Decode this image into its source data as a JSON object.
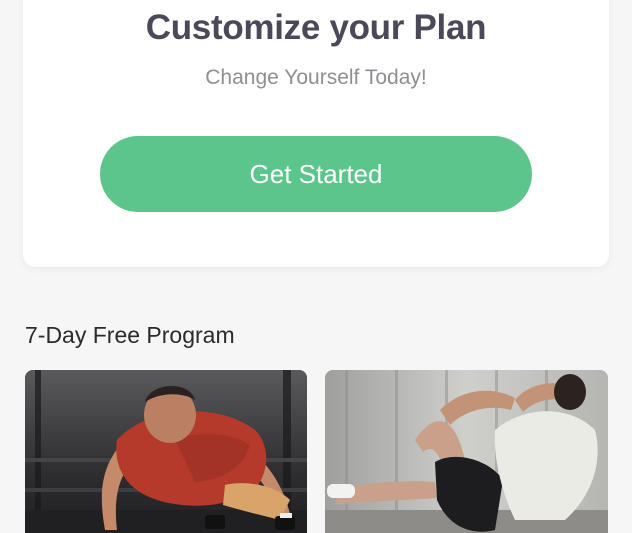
{
  "plan_card": {
    "title": "Customize your Plan",
    "subtitle": "Change Yourself Today!",
    "cta_label": "Get Started"
  },
  "program_section": {
    "title": "7-Day Free Program",
    "cards": [
      {
        "image": "man doing push-up in red t-shirt"
      },
      {
        "image": "man doing sit-up crunch in white tank top"
      }
    ]
  },
  "colors": {
    "accent": "#5cc58b",
    "title_text": "#4b4859",
    "subtitle_text": "#8e8e94",
    "background": "#f6f6f7"
  }
}
